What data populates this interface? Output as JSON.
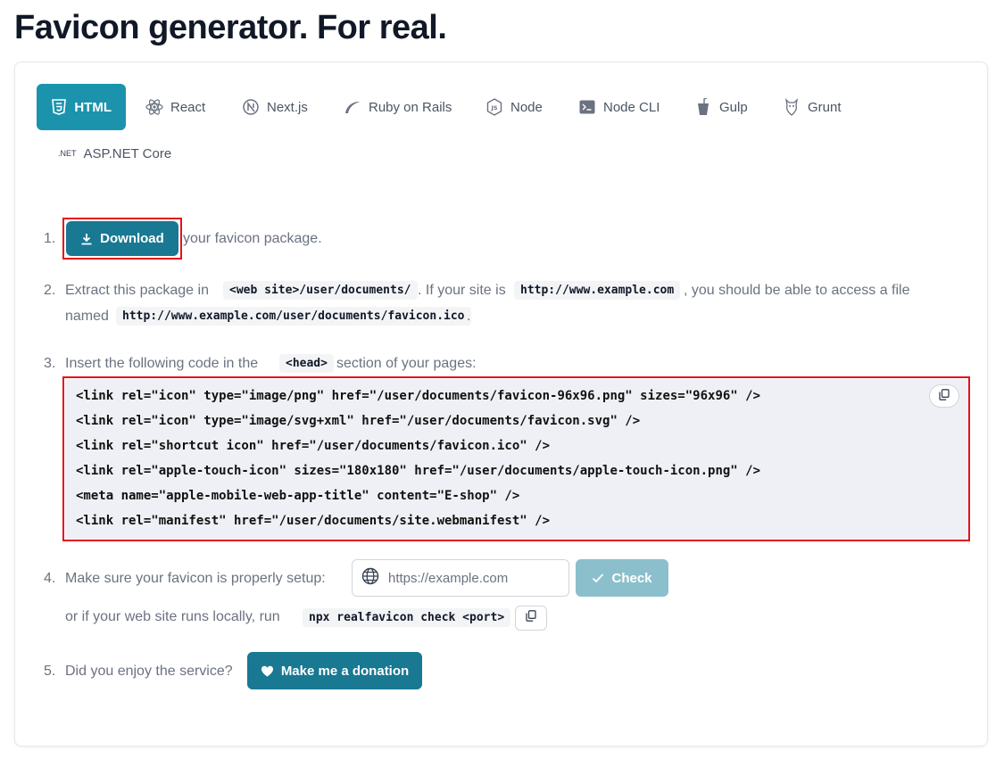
{
  "page": {
    "title": "Favicon generator. For real."
  },
  "tabs": [
    {
      "label": "HTML",
      "icon": "html5-icon",
      "active": true
    },
    {
      "label": "React",
      "icon": "react-icon"
    },
    {
      "label": "Next.js",
      "icon": "nextjs-icon"
    },
    {
      "label": "Ruby on Rails",
      "icon": "rails-icon"
    },
    {
      "label": "Node",
      "icon": "nodejs-icon"
    },
    {
      "label": "Node CLI",
      "icon": "terminal-icon"
    },
    {
      "label": "Gulp",
      "icon": "gulp-icon"
    },
    {
      "label": "Grunt",
      "icon": "grunt-icon"
    },
    {
      "label": "ASP.NET Core",
      "icon": "dotnet-icon",
      "icon_text": ".NET"
    }
  ],
  "steps": {
    "s1": {
      "num": "1.",
      "button": "Download",
      "text": "your favicon package."
    },
    "s2": {
      "num": "2.",
      "t1": "Extract this package in",
      "c1": "<web site>/user/documents/",
      "t2": ". If your site is",
      "c2": "http://www.example.com",
      "t3": ", you should be able to access a file",
      "t4": "named",
      "c3": "http://www.example.com/user/documents/favicon.ico",
      "t5": "."
    },
    "s3": {
      "num": "3.",
      "t1": "Insert the following code in the",
      "c1": "<head>",
      "t2": "section of your pages:",
      "code_lines": [
        "<link rel=\"icon\" type=\"image/png\" href=\"/user/documents/favicon-96x96.png\" sizes=\"96x96\" />",
        "<link rel=\"icon\" type=\"image/svg+xml\" href=\"/user/documents/favicon.svg\" />",
        "<link rel=\"shortcut icon\" href=\"/user/documents/favicon.ico\" />",
        "<link rel=\"apple-touch-icon\" sizes=\"180x180\" href=\"/user/documents/apple-touch-icon.png\" />",
        "<meta name=\"apple-mobile-web-app-title\" content=\"E-shop\" />",
        "<link rel=\"manifest\" href=\"/user/documents/site.webmanifest\" />"
      ]
    },
    "s4": {
      "num": "4.",
      "text": "Make sure your favicon is properly setup:",
      "placeholder": "https://example.com",
      "check": "Check",
      "t2": "or if your web site runs locally, run",
      "c1": "npx realfavicon check <port>"
    },
    "s5": {
      "num": "5.",
      "text": "Did you enjoy the service?",
      "button": "Make me a donation"
    }
  },
  "colors": {
    "primary": "#197892",
    "tab_active": "#1b93ad",
    "check_disabled": "#8cbfcc",
    "highlight": "#e4121b"
  }
}
